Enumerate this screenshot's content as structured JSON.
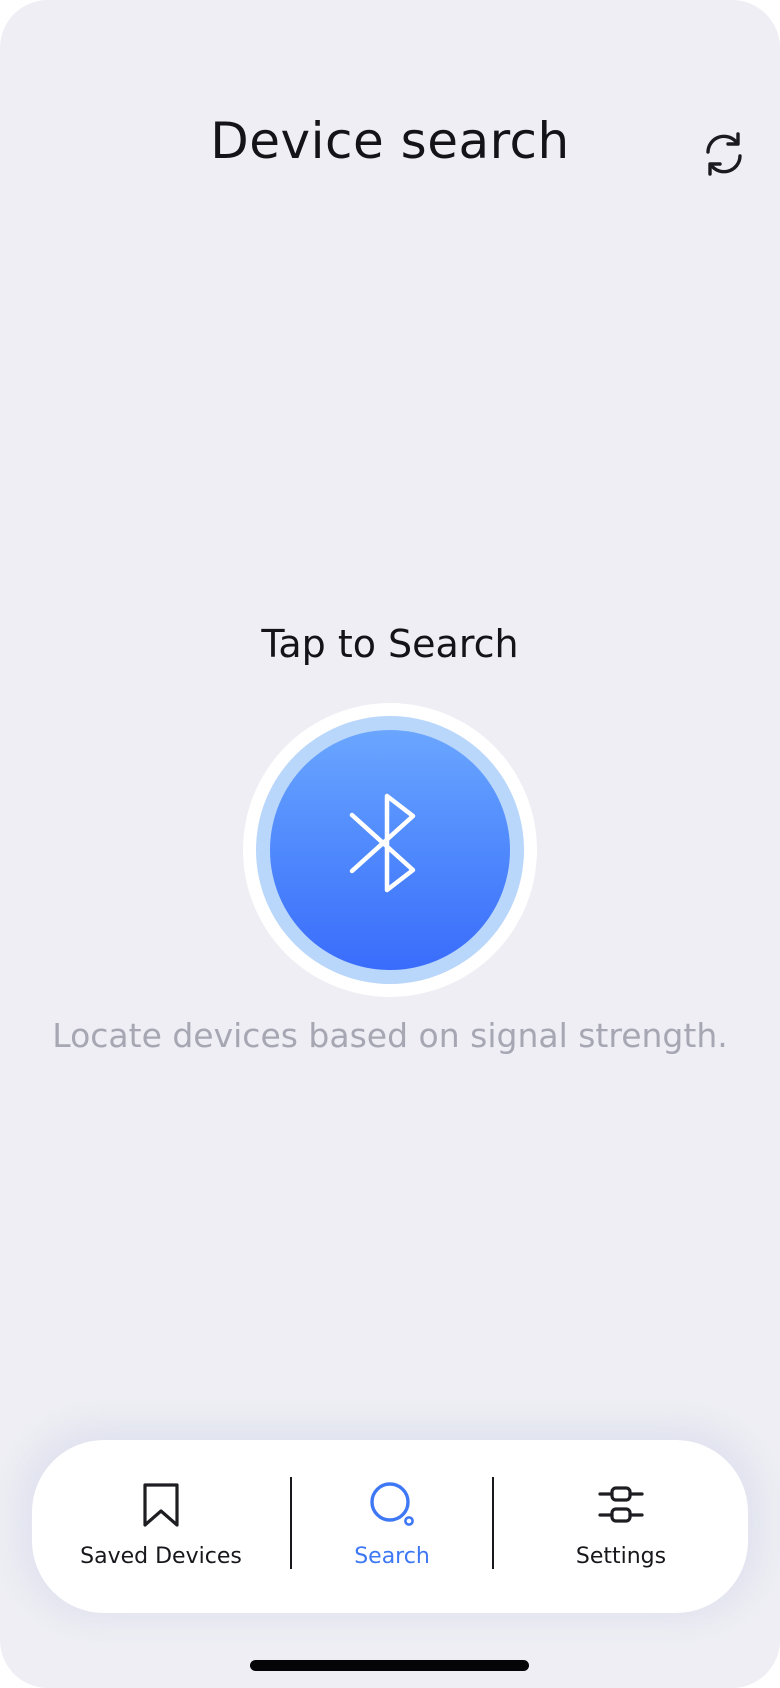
{
  "header": {
    "title": "Device search",
    "refresh_icon": "refresh-icon"
  },
  "main": {
    "prompt": "Tap to Search",
    "button_icon": "bluetooth-icon",
    "hint": "Locate devices based on signal strength."
  },
  "tabbar": {
    "tabs": [
      {
        "label": "Saved Devices",
        "icon": "bookmark-icon",
        "active": false
      },
      {
        "label": "Search",
        "icon": "search-icon",
        "active": true
      },
      {
        "label": "Settings",
        "icon": "sliders-icon",
        "active": false
      }
    ]
  },
  "colors": {
    "background": "#eeeef4",
    "accent": "#3e78f5",
    "orb_top": "#6aa6ff",
    "orb_bottom": "#3a6cfb",
    "orb_halo": "#b9d6fb",
    "hint_text": "#a7a7b4",
    "text_primary": "#141418"
  }
}
